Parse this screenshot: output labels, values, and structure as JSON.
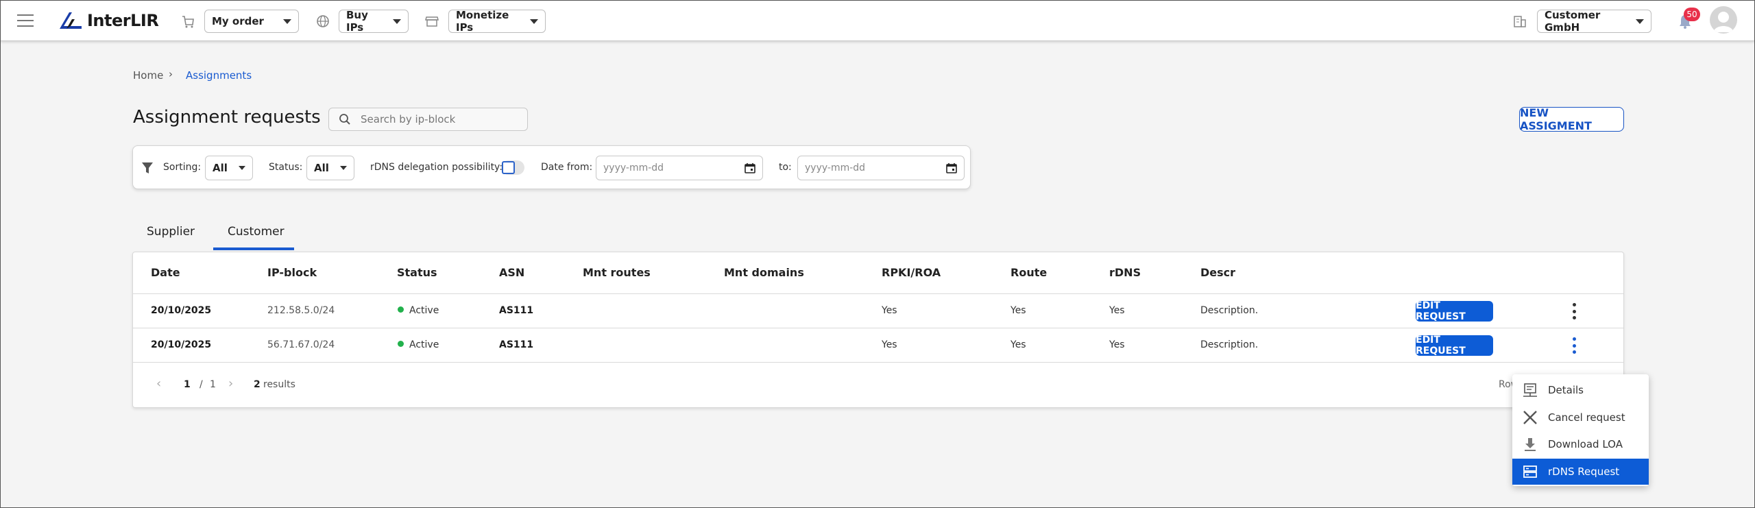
{
  "header": {
    "brand": "InterLIR",
    "my_order": "My order",
    "buy_ips": "Buy IPs",
    "monetize_ips": "Monetize IPs",
    "company": "Customer GmbH",
    "notifications_count": "50"
  },
  "breadcrumb": {
    "home": "Home",
    "separator": "›",
    "current": "Assignments"
  },
  "page": {
    "title": "Assignment requests",
    "search_placeholder": "Search by ip-block",
    "new_button": "NEW ASSIGMENT"
  },
  "filters": {
    "sorting_label": "Sorting:",
    "sorting_value": "All",
    "status_label": "Status:",
    "status_value": "All",
    "rdns_label": "rDNS delegation possibility:",
    "date_from_label": "Date from:",
    "date_from_placeholder": "yyyy-mm-dd",
    "to_label": "to:",
    "to_placeholder": "yyyy-mm-dd"
  },
  "tabs": [
    {
      "label": "Supplier",
      "active": false
    },
    {
      "label": "Customer",
      "active": true
    }
  ],
  "table": {
    "columns": [
      "Date",
      "IP-block",
      "Status",
      "ASN",
      "Mnt routes",
      "Mnt domains",
      "RPKI/ROA",
      "Route",
      "rDNS",
      "Descr"
    ],
    "rows": [
      {
        "date": "20/10/2025",
        "ip_block": "212.58.5.0/24",
        "status": "Active",
        "asn": "AS111",
        "mnt_routes": "",
        "mnt_domains": "",
        "rpki": "Yes",
        "route": "Yes",
        "rdns": "Yes",
        "descr": "Description.",
        "action": "EDIT REQUEST"
      },
      {
        "date": "20/10/2025",
        "ip_block": "56.71.67.0/24",
        "status": "Active",
        "asn": "AS111",
        "mnt_routes": "",
        "mnt_domains": "",
        "rpki": "Yes",
        "route": "Yes",
        "rdns": "Yes",
        "descr": "Description.",
        "action": "EDIT REQUEST"
      }
    ],
    "pagination": {
      "prev": "‹",
      "page": "1",
      "separator": "/",
      "total_pages": "1",
      "next": "›",
      "results_count": "2",
      "results_label": "results"
    },
    "rows_label_partial": "Row"
  },
  "context_menu": {
    "items": [
      {
        "label": "Details",
        "icon": "details-icon",
        "selected": false
      },
      {
        "label": "Cancel request",
        "icon": "close-icon",
        "selected": false
      },
      {
        "label": "Download LOA",
        "icon": "download-icon",
        "selected": false
      },
      {
        "label": "rDNS Request",
        "icon": "server-icon",
        "selected": true
      }
    ]
  },
  "colors": {
    "accent": "#0d5cd6",
    "link": "#1a5bd0",
    "status_active": "#22b14c",
    "badge": "#e8304a"
  }
}
